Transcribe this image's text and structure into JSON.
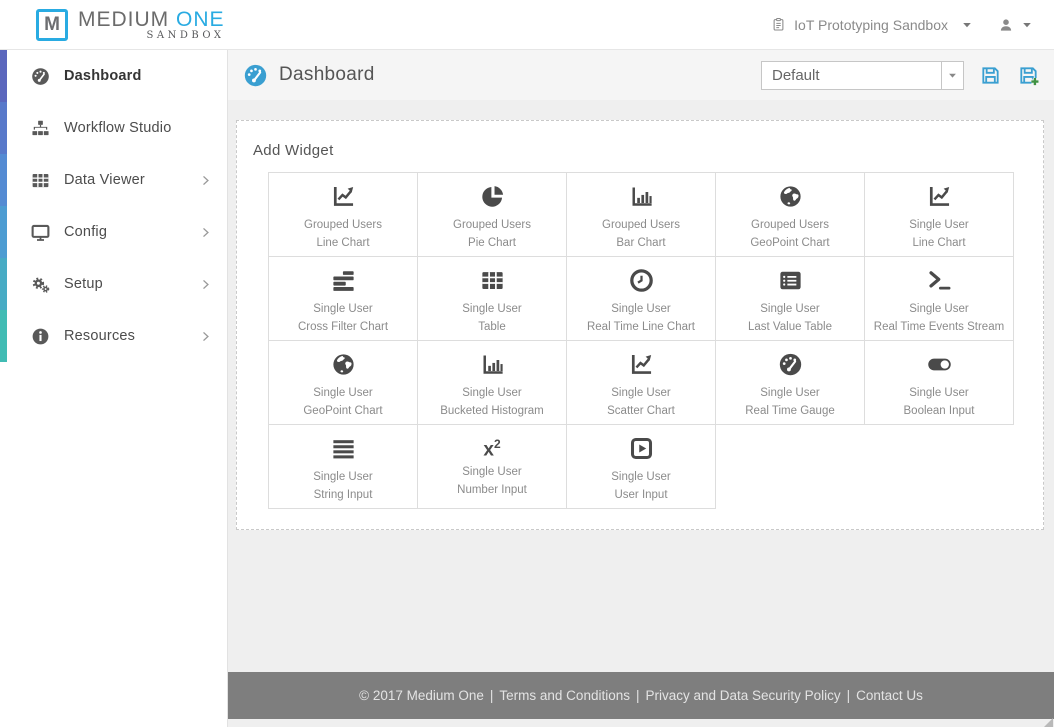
{
  "topbar": {
    "logo": {
      "mark": "M",
      "name_primary": "MEDIUM",
      "name_accent": "ONE",
      "subtitle": "SANDBOX"
    },
    "sandbox_selector": {
      "icon": "clipboard-icon",
      "label": "IoT Prototyping Sandbox",
      "caret_icon": "caret-down-icon"
    },
    "user_menu": {
      "icon": "user-icon",
      "caret_icon": "caret-down-icon"
    }
  },
  "sidebar": {
    "items": [
      {
        "label": "Dashboard",
        "icon": "gauge-icon",
        "active": true,
        "strip_color": "#5b67bd"
      },
      {
        "label": "Workflow Studio",
        "icon": "sitemap-icon",
        "active": false,
        "strip_color": "#5879ca"
      },
      {
        "label": "Data Viewer",
        "icon": "table-icon",
        "active": false,
        "strip_color": "#548bd3",
        "chevron_icon": "chevron-right-icon"
      },
      {
        "label": "Config",
        "icon": "monitor-icon",
        "active": false,
        "strip_color": "#4d9cd2",
        "chevron_icon": "chevron-right-icon"
      },
      {
        "label": "Setup",
        "icon": "gears-icon",
        "active": false,
        "strip_color": "#47abc4",
        "chevron_icon": "chevron-right-icon"
      },
      {
        "label": "Resources",
        "icon": "info-icon",
        "active": false,
        "strip_color": "#41bcb4",
        "chevron_icon": "chevron-right-icon"
      }
    ]
  },
  "main": {
    "header": {
      "icon": "gauge-icon",
      "title": "Dashboard",
      "preset_select": {
        "value": "Default",
        "caret_icon": "caret-down-icon"
      },
      "save_icon": "save-icon",
      "save_as_icon": "save-plus-icon"
    },
    "panel": {
      "title": "Add Widget"
    },
    "widgets": [
      {
        "icon": "line-chart-icon",
        "line1": "Grouped Users",
        "line2": "Line Chart"
      },
      {
        "icon": "pie-chart-icon",
        "line1": "Grouped Users",
        "line2": "Pie Chart"
      },
      {
        "icon": "bar-chart-icon",
        "line1": "Grouped Users",
        "line2": "Bar Chart"
      },
      {
        "icon": "globe-icon",
        "line1": "Grouped Users",
        "line2": "GeoPoint Chart"
      },
      {
        "icon": "line-chart-icon",
        "line1": "Single User",
        "line2": "Line Chart"
      },
      {
        "icon": "cross-filter-icon",
        "line1": "Single User",
        "line2": "Cross Filter Chart"
      },
      {
        "icon": "table-icon",
        "line1": "Single User",
        "line2": "Table"
      },
      {
        "icon": "clock-icon",
        "line1": "Single User",
        "line2": "Real Time Line Chart"
      },
      {
        "icon": "list-table-icon",
        "line1": "Single User",
        "line2": "Last Value Table"
      },
      {
        "icon": "terminal-icon",
        "line1": "Single User",
        "line2": "Real Time Events Stream"
      },
      {
        "icon": "globe-icon",
        "line1": "Single User",
        "line2": "GeoPoint Chart"
      },
      {
        "icon": "bar-chart-icon",
        "line1": "Single User",
        "line2": "Bucketed Histogram"
      },
      {
        "icon": "line-chart-icon",
        "line1": "Single User",
        "line2": "Scatter Chart"
      },
      {
        "icon": "gauge-icon",
        "line1": "Single User",
        "line2": "Real Time Gauge"
      },
      {
        "icon": "toggle-icon",
        "line1": "Single User",
        "line2": "Boolean Input"
      },
      {
        "icon": "align-justify-icon",
        "line1": "Single User",
        "line2": "String Input"
      },
      {
        "icon": "x2-icon",
        "line1": "Single User",
        "line2": "Number Input"
      },
      {
        "icon": "play-square-icon",
        "line1": "Single User",
        "line2": "User Input"
      }
    ]
  },
  "footer": {
    "copyright": "© 2017 Medium One",
    "separator": "|",
    "links": [
      "Terms and Conditions",
      "Privacy and Data Security Policy",
      "Contact Us"
    ]
  },
  "colors": {
    "accent_blue": "#3a9fd1",
    "logo_cyan": "#29abe2",
    "footer_gray": "#7e7e7e"
  }
}
